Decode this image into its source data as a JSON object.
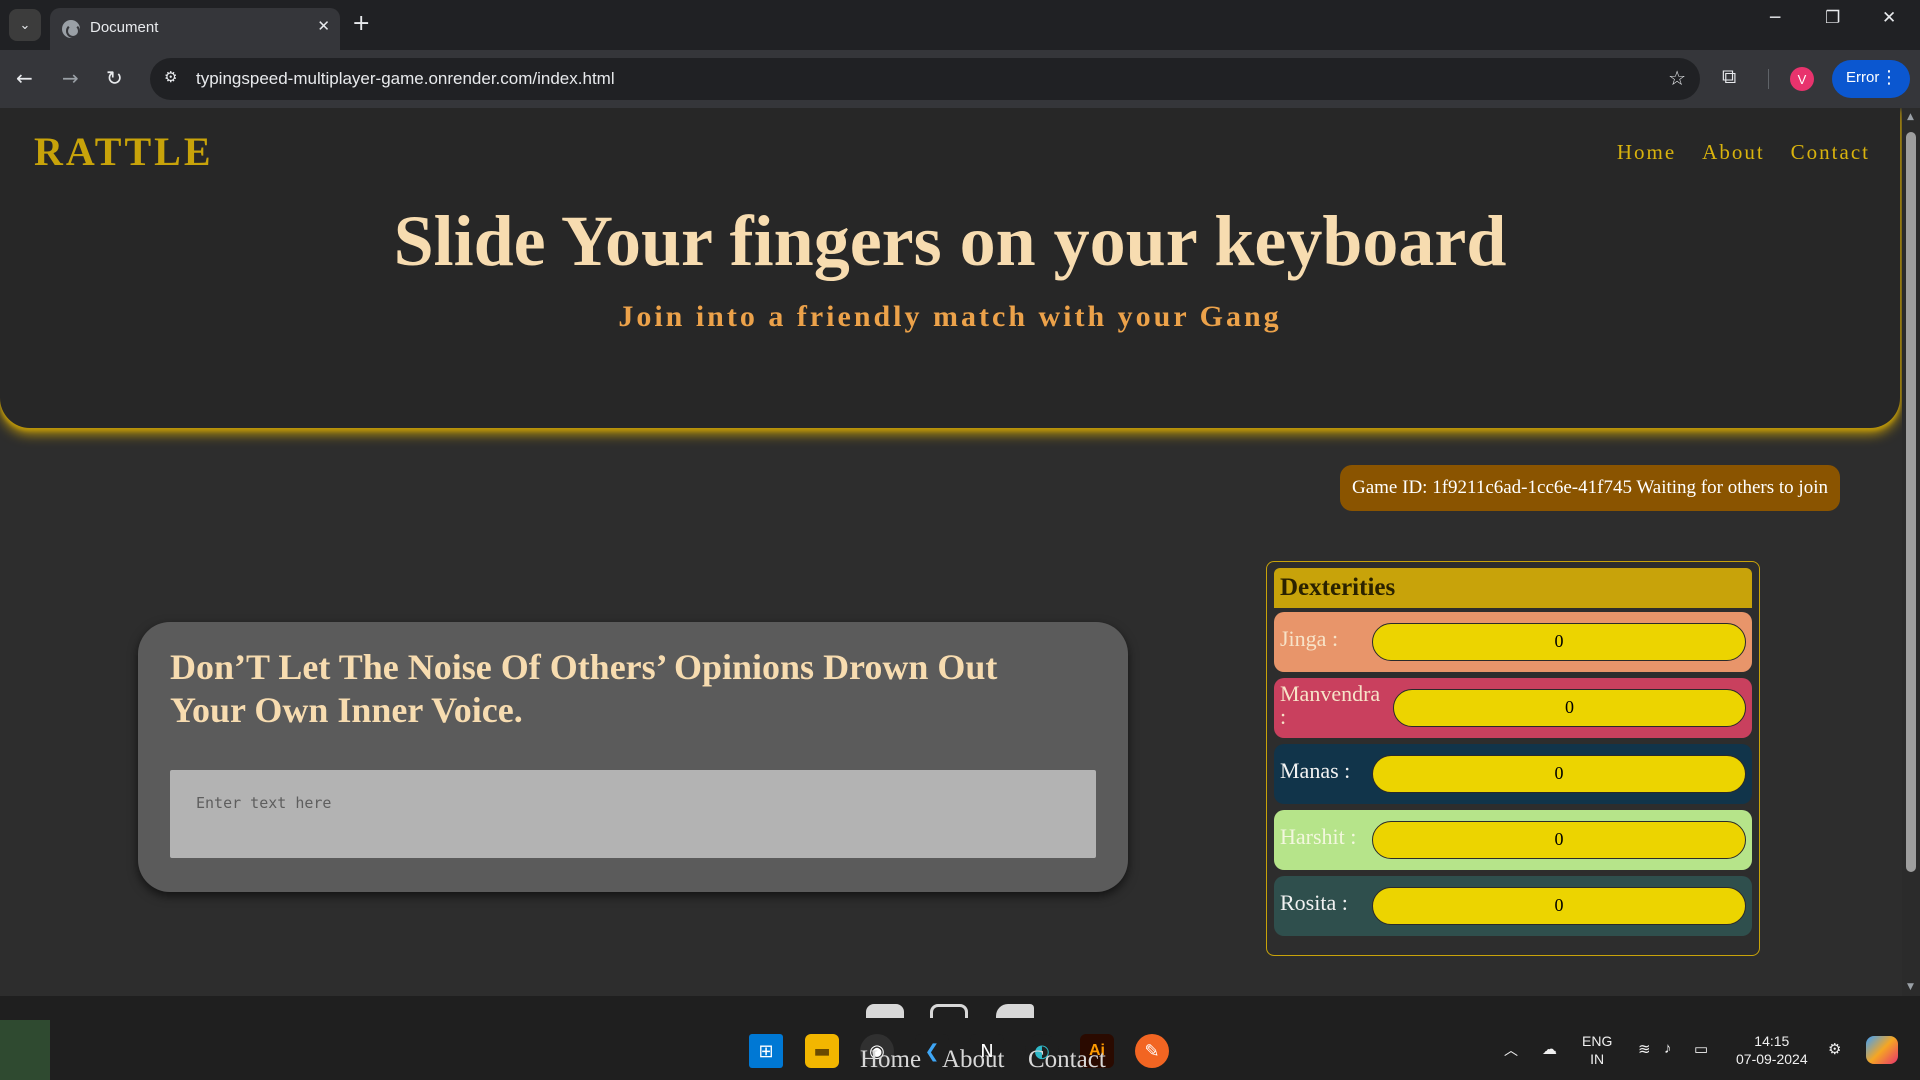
{
  "browser": {
    "tab_title": "Document",
    "tab_close": "✕",
    "new_tab": "+",
    "url": "typingspeed-multiplayer-game.onrender.com/index.html",
    "profile_initial": "V",
    "error_label": "Error"
  },
  "site": {
    "brand": "RATTLE",
    "nav": [
      "Home",
      "About",
      "Contact"
    ],
    "hero_title": "Slide Your fingers on your keyboard",
    "hero_subtitle": "Join into a friendly match with your Gang",
    "game_status": "Game ID: 1f9211c6ad-1cc6e-41f745 Waiting for others to join",
    "quote": "Don’T Let The Noise Of Others’ Opinions Drown Out Your Own Inner Voice.",
    "input_placeholder": "Enter text here",
    "scoreboard": {
      "title": "Dexterities",
      "players": [
        {
          "name": "Jinga :",
          "score": "0",
          "bg": "#e8956a",
          "fg": "#f7e3c8"
        },
        {
          "name": "Manvendra :",
          "score": "0",
          "bg": "#c9405e",
          "fg": "#f7e3c8"
        },
        {
          "name": "Manas :",
          "score": "0",
          "bg": "#11344a",
          "fg": "#f2f2f2"
        },
        {
          "name": "Harshit :",
          "score": "0",
          "bg": "#b6e48a",
          "fg": "#f3f7de"
        },
        {
          "name": "Rosita :",
          "score": "0",
          "bg": "#2f4f4d",
          "fg": "#f2f2f2"
        }
      ]
    },
    "footer_links": [
      "Home",
      "About",
      "Contact"
    ]
  },
  "taskbar": {
    "lang_top": "ENG",
    "lang_bottom": "IN",
    "time": "14:15",
    "date": "07-09-2024"
  },
  "colors": {
    "accent_gold": "#c8a30a",
    "hero_title": "#f7dcb0",
    "hero_sub": "#eca24a",
    "status_bg": "#8a5400",
    "bar_yellow": "#ecd400"
  },
  "icons": [
    "tab-search-icon",
    "globe-icon",
    "back-arrow-icon",
    "forward-arrow-icon",
    "reload-icon",
    "site-info-icon",
    "star-icon",
    "extensions-icon",
    "windows-start-icon",
    "file-explorer-icon",
    "chrome-icon",
    "vscode-icon",
    "notion-icon",
    "edge-icon",
    "illustrator-icon",
    "pen-app-icon",
    "wifi-icon",
    "volume-icon",
    "battery-icon",
    "cloud-icon",
    "chevron-up-icon"
  ]
}
